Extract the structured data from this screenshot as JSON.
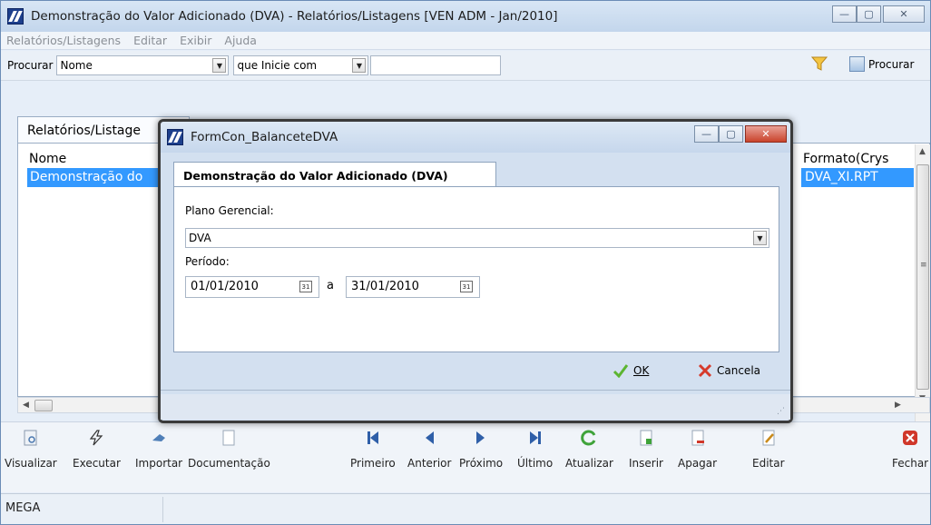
{
  "window": {
    "title": "Demonstração do Valor Adicionado (DVA) -  Relatórios/Listagens [VEN ADM - Jan/2010]",
    "minimize": "—",
    "maximize": "▢",
    "close": "✕"
  },
  "menu": [
    "Relatórios/Listagens",
    "Editar",
    "Exibir",
    "Ajuda"
  ],
  "search": {
    "label": "Procurar",
    "field_value": "Nome",
    "condition_value": "que Inicie com",
    "query_value": "",
    "button_label": "Procurar"
  },
  "list": {
    "tab_label": "Relatórios/Listage",
    "col_name": "Nome",
    "col_format": "Formato(Crys",
    "row_name": "Demonstração do",
    "row_format": "DVA_XI.RPT"
  },
  "dialog": {
    "title": "FormCon_BalanceteDVA",
    "tab_label": "Demonstração do Valor Adicionado (DVA)",
    "plano_label": "Plano Gerencial:",
    "plano_value": "DVA",
    "periodo_label": "Período:",
    "date_from": "01/01/2010",
    "date_sep": "a",
    "date_to": "31/01/2010",
    "ok_label": "OK",
    "cancel_label": "Cancela"
  },
  "toolbar": [
    {
      "label": "Visualizar",
      "icon": "preview-icon"
    },
    {
      "label": "Executar",
      "icon": "lightning-icon"
    },
    {
      "label": "Importar",
      "icon": "import-icon"
    },
    {
      "label": "Documentação",
      "icon": "document-icon"
    },
    {
      "label": "Primeiro",
      "icon": "first-icon"
    },
    {
      "label": "Anterior",
      "icon": "previous-icon"
    },
    {
      "label": "Próximo",
      "icon": "next-icon"
    },
    {
      "label": "Último",
      "icon": "last-icon"
    },
    {
      "label": "Atualizar",
      "icon": "refresh-icon"
    },
    {
      "label": "Inserir",
      "icon": "insert-icon"
    },
    {
      "label": "Apagar",
      "icon": "delete-icon"
    },
    {
      "label": "Editar",
      "icon": "edit-icon"
    },
    {
      "label": "Fechar",
      "icon": "close-icon"
    }
  ],
  "status": {
    "text": "MEGA"
  },
  "colors": {
    "selection": "#3399ff",
    "nav_blue": "#2f5fa8",
    "refresh_green": "#3fa33a",
    "close_red": "#d0372a"
  }
}
